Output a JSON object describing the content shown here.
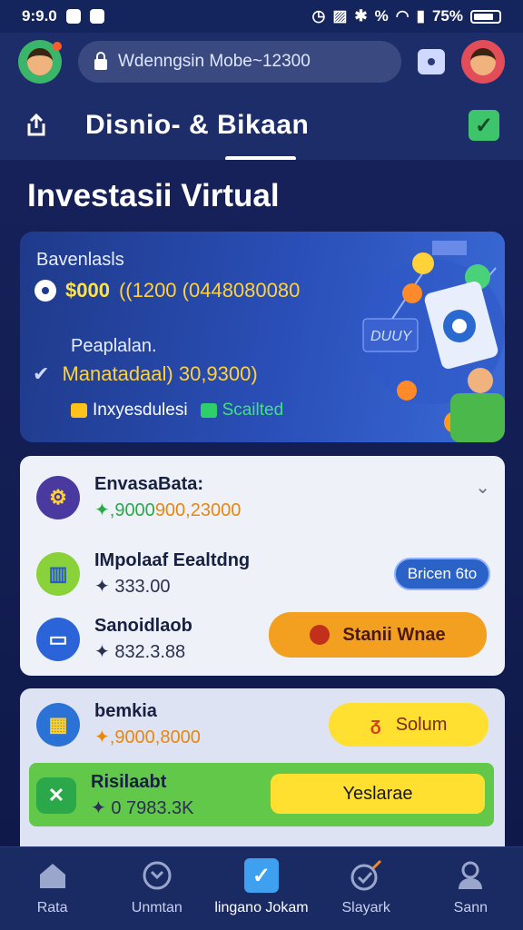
{
  "status_bar": {
    "time": "9:9.0",
    "battery": "75%"
  },
  "top_bar": {
    "url": "Wdenngsin Mobe~12300"
  },
  "header": {
    "title": "Disnio- &  Bikaan"
  },
  "section": {
    "title": "Investasii Virtual"
  },
  "hero": {
    "label_1": "Bavenlasls",
    "amount_1": "$000",
    "amount_2": "((1200 (0448080080",
    "label_2": "Peaplalan.",
    "value_2": "Manatadaal) 30,9300)",
    "tag_1": "Inxyesdulesi",
    "tag_2": "Scailted",
    "banner_text": "DUUY"
  },
  "card1": {
    "rows": [
      {
        "name": "EnvasaBata:",
        "value_prefix": "✦,9000",
        "value_suffix": "900,23000"
      },
      {
        "name": "IMpolaaf Eealtdng",
        "value": "✦ 333.00",
        "button": "Bricen 6to"
      },
      {
        "name": "Sanoidlaob",
        "value": "✦ 832.3.88",
        "button": "Stanii Wnae"
      }
    ]
  },
  "card2": {
    "rows": [
      {
        "name": "bemkia",
        "value": "✦,9000,8000",
        "button": "Solum"
      },
      {
        "name": "Risilaabt",
        "value": "✦ 0 7983.3K",
        "button": "Yeslarae"
      }
    ]
  },
  "bottom_nav": [
    {
      "label": "Rata",
      "icon": "home-icon"
    },
    {
      "label": "Unmtan",
      "icon": "compass-icon"
    },
    {
      "label": "lingano Jokam",
      "icon": "check-square-icon"
    },
    {
      "label": "Slayark",
      "icon": "target-icon"
    },
    {
      "label": "Sann",
      "icon": "user-icon"
    }
  ],
  "colors": {
    "accent": "#3fa0f0",
    "orange_button": "#f3a020",
    "yellow_button": "#ffe030",
    "green_row": "#62c84a"
  }
}
